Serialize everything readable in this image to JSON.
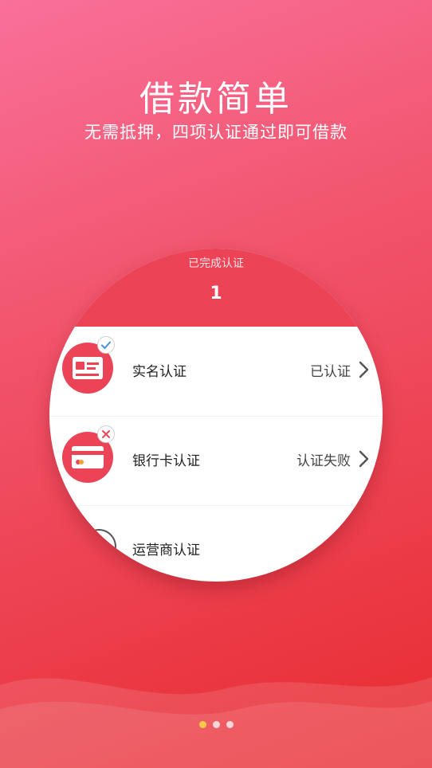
{
  "hero": {
    "title": "借款简单",
    "subtitle": "无需抵押，四项认证通过即可借款"
  },
  "card": {
    "header_label": "已完成认证",
    "completed_count": "1",
    "items": [
      {
        "label": "实名认证",
        "status": "已认证",
        "icon": "id-card-icon",
        "badge": "check-badge-icon"
      },
      {
        "label": "银行卡认证",
        "status": "认证失败",
        "icon": "bank-card-icon",
        "badge": "x-badge-icon"
      },
      {
        "label": "运营商认证",
        "status": "",
        "icon": "carrier-icon",
        "badge": ""
      }
    ]
  },
  "pager": {
    "total": 3,
    "active": 0
  },
  "colors": {
    "accent": "#ec4357",
    "active_dot": "#f7c948",
    "background_top": "#f9709a",
    "background_bottom": "#e82a2f"
  }
}
